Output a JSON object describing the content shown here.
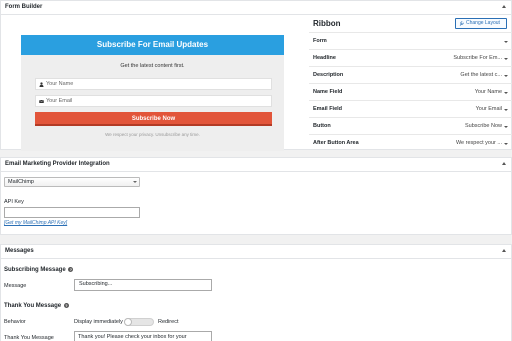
{
  "form_builder": {
    "title": "Form Builder",
    "preview": {
      "headline": "Subscribe For Email Updates",
      "description": "Get the latest content first.",
      "name_placeholder": "Your Name",
      "email_placeholder": "Your Email",
      "button": "Subscribe Now",
      "after_button": "We respect your privacy. Unsubscribe any time."
    },
    "settings": {
      "layout_name": "Ribbon",
      "change_layout_label": "Change Layout",
      "rows": [
        {
          "label": "Form",
          "value": ""
        },
        {
          "label": "Headline",
          "value": "Subscribe For Em..."
        },
        {
          "label": "Description",
          "value": "Get the latest c..."
        },
        {
          "label": "Name Field",
          "value": "Your Name"
        },
        {
          "label": "Email Field",
          "value": "Your Email"
        },
        {
          "label": "Button",
          "value": "Subscribe Now"
        },
        {
          "label": "After Button Area",
          "value": "We respect your ..."
        }
      ]
    }
  },
  "provider": {
    "title": "Email Marketing Provider Integration",
    "selected": "MailChimp",
    "api_key_label": "API Key",
    "api_key_value": "",
    "api_key_link": "[Get my MailChimp API Key]"
  },
  "messages": {
    "title": "Messages",
    "subscribing_heading": "Subscribing Message",
    "message_label": "Message",
    "subscribing_value": "Subscribing...",
    "thank_you_heading": "Thank You Message",
    "behavior_label": "Behavior",
    "behavior_left": "Display immediately",
    "behavior_right": "Redirect",
    "thank_you_label": "Thank You Message",
    "thank_you_value": "Thank you! Please check your inbox for your"
  }
}
